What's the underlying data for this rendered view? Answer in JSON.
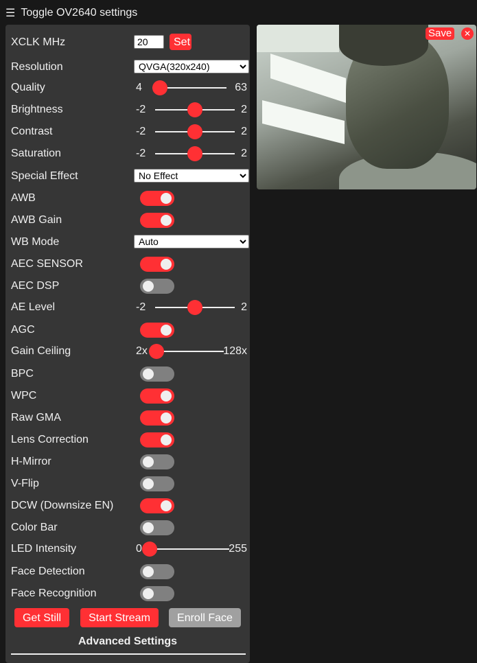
{
  "header": {
    "menu_icon": "hamburger-icon",
    "glyph": "☰",
    "title": "Toggle OV2640 settings"
  },
  "xclk": {
    "label": "XCLK MHz",
    "value": "20",
    "set_label": "Set"
  },
  "resolution": {
    "label": "Resolution",
    "selected": "QVGA(320x240)"
  },
  "quality": {
    "label": "Quality",
    "min": "4",
    "max": "63",
    "value": 10
  },
  "brightness": {
    "label": "Brightness",
    "min": "-2",
    "max": "2",
    "value": 0
  },
  "contrast": {
    "label": "Contrast",
    "min": "-2",
    "max": "2",
    "value": 0
  },
  "saturation": {
    "label": "Saturation",
    "min": "-2",
    "max": "2",
    "value": 0
  },
  "special_effect": {
    "label": "Special Effect",
    "selected": "No Effect"
  },
  "awb": {
    "label": "AWB",
    "on": true
  },
  "awb_gain": {
    "label": "AWB Gain",
    "on": true
  },
  "wb_mode": {
    "label": "WB Mode",
    "selected": "Auto"
  },
  "aec_sensor": {
    "label": "AEC SENSOR",
    "on": true
  },
  "aec_dsp": {
    "label": "AEC DSP",
    "on": false
  },
  "ae_level": {
    "label": "AE Level",
    "min": "-2",
    "max": "2",
    "value": 0
  },
  "agc": {
    "label": "AGC",
    "on": true
  },
  "gain_ceiling": {
    "label": "Gain Ceiling",
    "min": "2x",
    "max": "128x",
    "value": 0
  },
  "bpc": {
    "label": "BPC",
    "on": false
  },
  "wpc": {
    "label": "WPC",
    "on": true
  },
  "raw_gma": {
    "label": "Raw GMA",
    "on": true
  },
  "lens_correction": {
    "label": "Lens Correction",
    "on": true
  },
  "h_mirror": {
    "label": "H-Mirror",
    "on": false
  },
  "v_flip": {
    "label": "V-Flip",
    "on": false
  },
  "dcw": {
    "label": "DCW (Downsize EN)",
    "on": true
  },
  "color_bar": {
    "label": "Color Bar",
    "on": false
  },
  "led_intensity": {
    "label": "LED Intensity",
    "min": "0",
    "max": "255",
    "value": 0
  },
  "face_detection": {
    "label": "Face Detection",
    "on": false
  },
  "face_recognition": {
    "label": "Face Recognition",
    "on": false
  },
  "buttons": {
    "get_still": "Get Still",
    "start_stream": "Start Stream",
    "enroll_face": "Enroll Face"
  },
  "advanced": {
    "title": "Advanced Settings"
  },
  "stream": {
    "save_label": "Save",
    "close_glyph": "✕"
  },
  "colors": {
    "accent": "#ff3034",
    "panel": "#363636",
    "background": "#181818",
    "off": "#808080"
  }
}
